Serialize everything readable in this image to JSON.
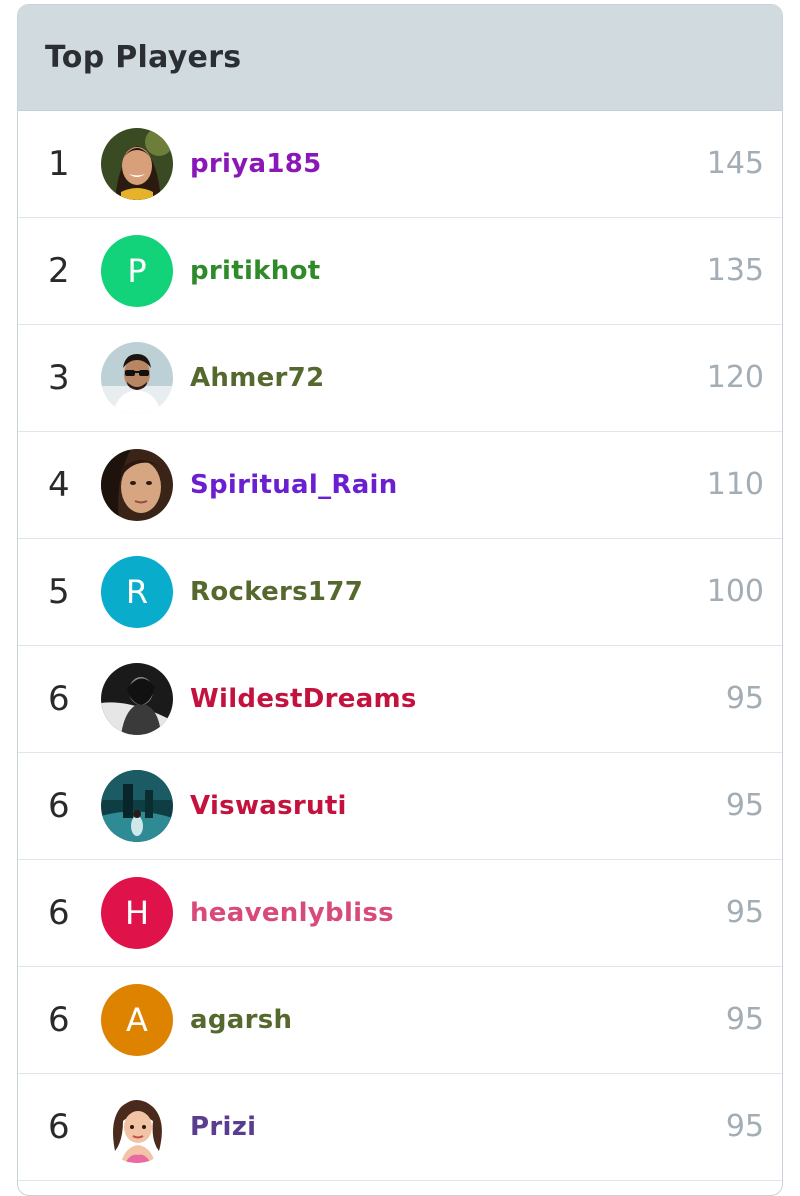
{
  "leaderboard": {
    "title": "Top Players",
    "players": [
      {
        "rank": "1",
        "name": "priya185",
        "score": "145",
        "name_color": "#8a17b8",
        "avatar": {
          "kind": "photo",
          "icon": "woman-portrait-photo"
        }
      },
      {
        "rank": "2",
        "name": "pritikhot",
        "score": "135",
        "name_color": "#2f8a2a",
        "avatar": {
          "kind": "initial",
          "letter": "P",
          "color": "#12d27a"
        }
      },
      {
        "rank": "3",
        "name": "Ahmer72",
        "score": "120",
        "name_color": "#55682e",
        "avatar": {
          "kind": "photo",
          "icon": "man-sunglasses-photo"
        }
      },
      {
        "rank": "4",
        "name": "Spiritual_Rain",
        "score": "110",
        "name_color": "#6a1fd0",
        "avatar": {
          "kind": "photo",
          "icon": "woman-closeup-photo"
        }
      },
      {
        "rank": "5",
        "name": "Rockers177",
        "score": "100",
        "name_color": "#55682e",
        "avatar": {
          "kind": "initial",
          "letter": "R",
          "color": "#0aaccc"
        }
      },
      {
        "rank": "6",
        "name": "WildestDreams",
        "score": "95",
        "name_color": "#c4123e",
        "avatar": {
          "kind": "photo",
          "icon": "monochrome-portrait-photo"
        }
      },
      {
        "rank": "6",
        "name": "Viswasruti",
        "score": "95",
        "name_color": "#c4123e",
        "avatar": {
          "kind": "photo",
          "icon": "teal-scene-photo"
        }
      },
      {
        "rank": "6",
        "name": "heavenlybliss",
        "score": "95",
        "name_color": "#d84a77",
        "avatar": {
          "kind": "initial",
          "letter": "H",
          "color": "#e0124a"
        }
      },
      {
        "rank": "6",
        "name": "agarsh",
        "score": "95",
        "name_color": "#55682e",
        "avatar": {
          "kind": "initial",
          "letter": "A",
          "color": "#de8300"
        }
      },
      {
        "rank": "6",
        "name": "Prizi",
        "score": "95",
        "name_color": "#5a3d8f",
        "avatar": {
          "kind": "photo",
          "icon": "cartoon-girl-avatar"
        }
      }
    ]
  }
}
